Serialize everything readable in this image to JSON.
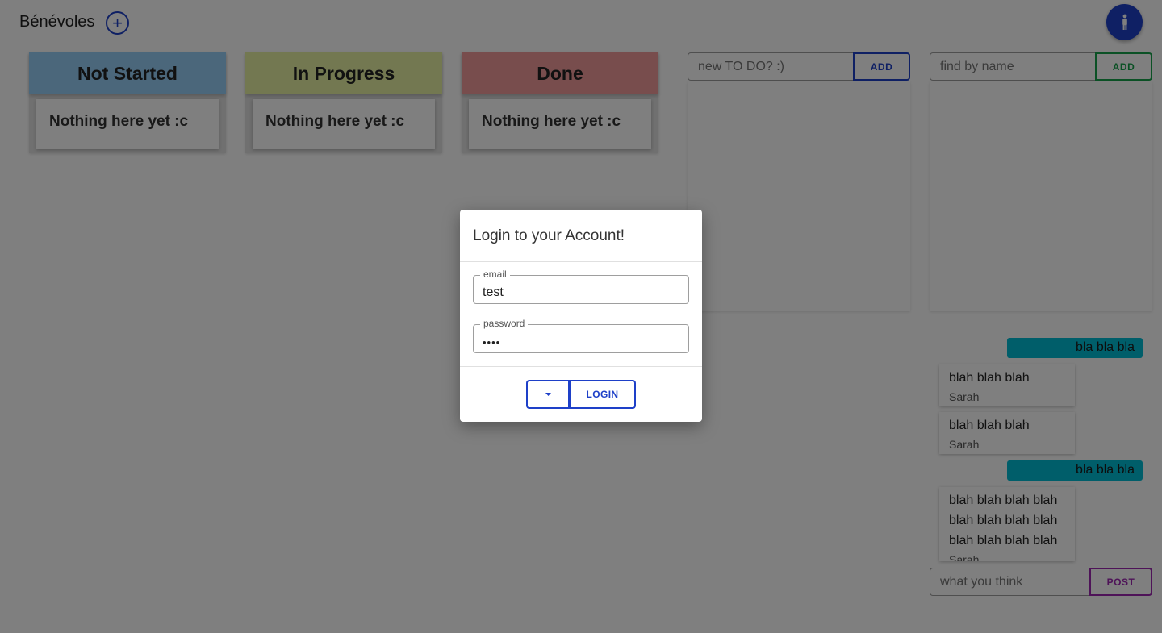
{
  "app": {
    "title": "Bénévoles",
    "add_icon": "plus-circle-icon",
    "profile_icon": "person-icon",
    "accent_color": "#1e40c8"
  },
  "columns": [
    {
      "title": "Not Started",
      "color": "#96cff7",
      "card_text": "Nothing here yet :c"
    },
    {
      "title": "In Progress",
      "color": "#e6f0a3",
      "card_text": "Nothing here yet :c"
    },
    {
      "title": "Done",
      "color": "#f09b9b",
      "card_text": "Nothing here yet :c"
    }
  ],
  "todo_panel": {
    "placeholder": "new TO DO? :)",
    "button_label": "ADD",
    "button_color": "#1e40c8"
  },
  "search_panel": {
    "placeholder": "find by name",
    "button_label": "ADD",
    "button_color": "#16a34a"
  },
  "chat": {
    "messages": [
      {
        "mine": true,
        "text": "bla bla bla"
      },
      {
        "mine": false,
        "lines": [
          "blah blah blah"
        ],
        "author": "Sarah"
      },
      {
        "mine": false,
        "lines": [
          "blah blah blah"
        ],
        "author": "Sarah"
      },
      {
        "mine": true,
        "text": "bla bla bla"
      },
      {
        "mine": false,
        "lines": [
          "blah blah blah blah",
          "blah blah blah blah",
          "blah blah blah blah"
        ],
        "author": "Sarah"
      }
    ],
    "input_placeholder": "what you think",
    "post_label": "POST",
    "post_color": "#9c27b0"
  },
  "dialog": {
    "title": "Login to your Account!",
    "email_label": "email",
    "email_value": "test",
    "password_label": "password",
    "password_value": "••••",
    "dropdown_icon": "caret-down-icon",
    "login_label": "LOGIN"
  }
}
